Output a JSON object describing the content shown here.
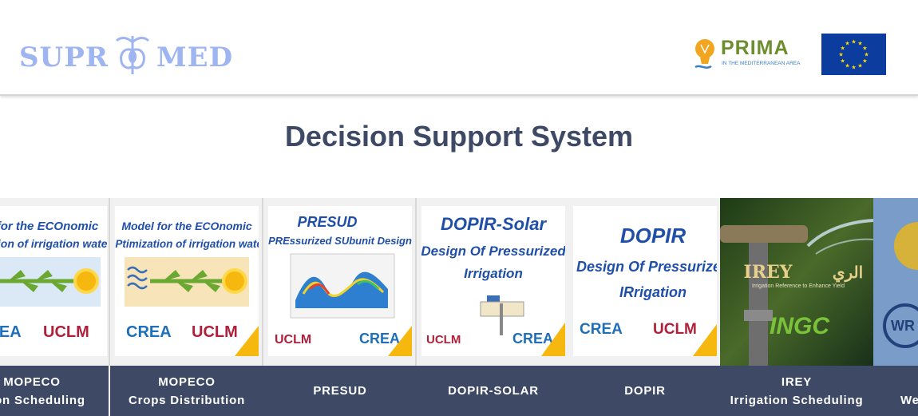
{
  "header": {
    "logo_left": "SUPR",
    "logo_right": "MED",
    "partner_name": "PRIMA",
    "partner_tagline": "IN THE MEDITERRANEAN AREA"
  },
  "page_title": "Decision Support System",
  "cards": [
    {
      "label_line1": "MOPECO",
      "label_line2": "ation Scheduling",
      "img_title1": "odel for the ECOnomic",
      "img_title2": "ptimization of irrigation water",
      "logo_a": "CREA",
      "logo_b": "UCLM"
    },
    {
      "label_line1": "MOPECO",
      "label_line2": "Crops Distribution",
      "img_title1": "Model for the ECOnomic",
      "img_title2": "OPtimization of irrigation water",
      "logo_a": "CREA",
      "logo_b": "UCLM"
    },
    {
      "label_line1": "PRESUD",
      "img_title1": "PRESUD",
      "img_title2": "PREssurized SUbunit Design",
      "logo_a": "UCLM",
      "logo_b": "CREA"
    },
    {
      "label_line1": "DOPIR-SOLAR",
      "img_title1": "DOPIR-Solar",
      "img_title2": "Design Of Pressurized",
      "img_title3": "Irrigation",
      "logo_a": "UCLM",
      "logo_b": "CREA"
    },
    {
      "label_line1": "DOPIR",
      "img_title1": "DOPIR",
      "img_title2": "Design Of Pressurized",
      "img_title3": "IRrigation",
      "logo_a": "CREA",
      "logo_b": "UCLM"
    },
    {
      "label_line1": "IREY",
      "label_line2": "Irrigation Scheduling",
      "img_title1": "IREY",
      "img_title2": "الري",
      "img_sub": "Irrigation Reference to Enhance Yield",
      "logo_a": "INGC"
    },
    {
      "label_line1": "We",
      "logo_a": "WR"
    }
  ],
  "colors": {
    "label_bg": "#3d4965",
    "title": "#3d4965",
    "logo": "#9fb5f2",
    "prima_green": "#6d8e2f",
    "eu_blue": "#0c3d9e",
    "eu_star": "#ffdd00"
  }
}
